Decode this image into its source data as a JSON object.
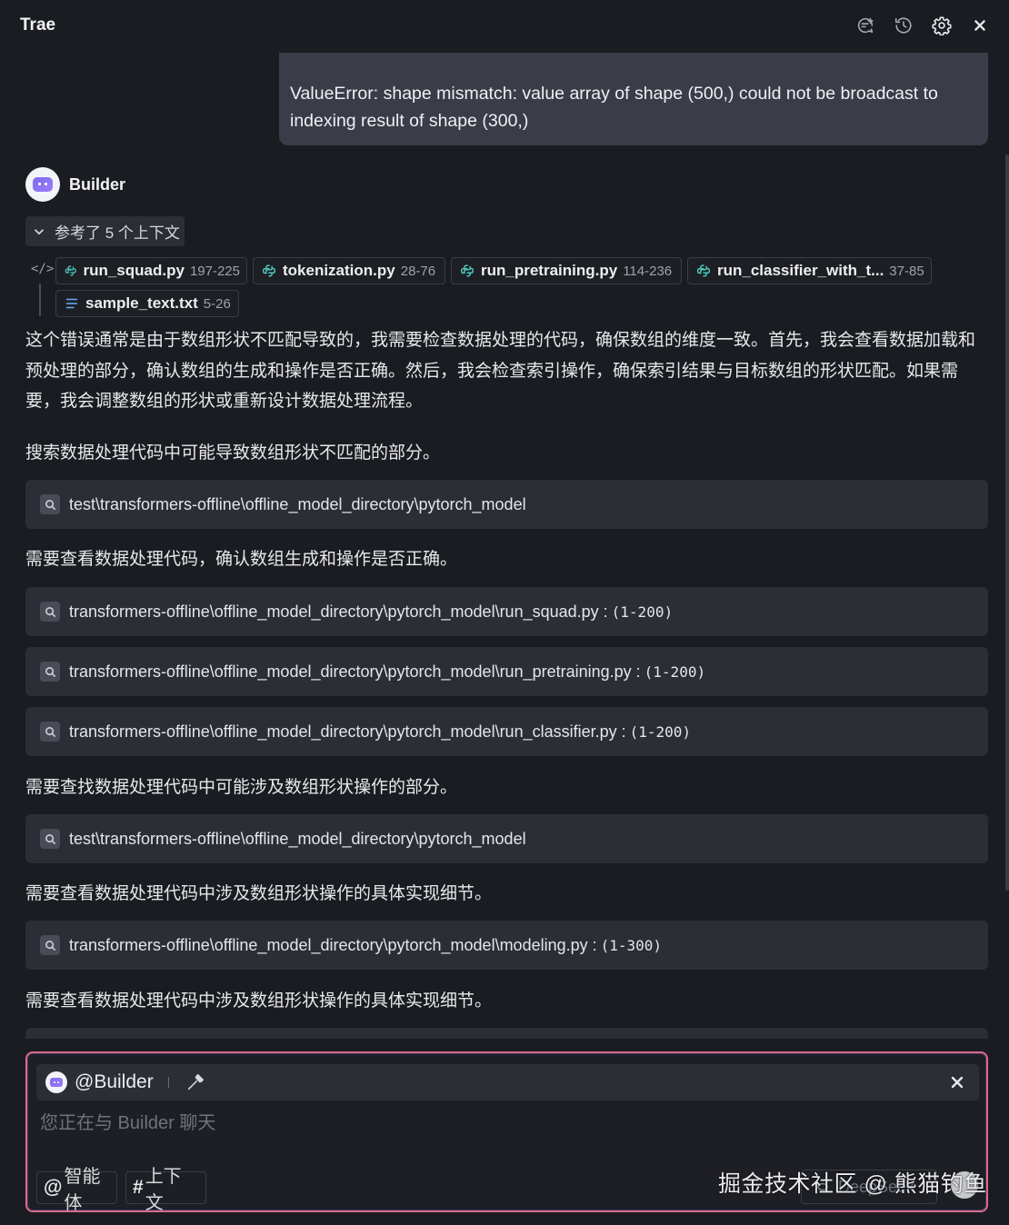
{
  "header": {
    "title": "Trae",
    "icons": [
      "new-chat-icon",
      "history-icon",
      "gear-icon",
      "close-icon"
    ]
  },
  "user_message": {
    "text": "ValueError: shape mismatch: value array of shape (500,) could not be broadcast to indexing result of shape (300,)"
  },
  "assistant": {
    "name": "Builder",
    "context_toggle": "参考了 5 个上下文",
    "context_files": [
      {
        "name": "run_squad.py",
        "range": "197-225",
        "icon": "python-icon"
      },
      {
        "name": "tokenization.py",
        "range": "28-76",
        "icon": "python-icon"
      },
      {
        "name": "run_pretraining.py",
        "range": "114-236",
        "icon": "python-icon"
      },
      {
        "name": "run_classifier_with_t...",
        "range": "37-85",
        "icon": "python-icon"
      },
      {
        "name": "sample_text.txt",
        "range": "5-26",
        "icon": "text-file-icon"
      }
    ]
  },
  "messages": {
    "intro": "这个错误通常是由于数组形状不匹配导致的，我需要检查数据处理的代码，确保数组的维度一致。首先，我会查看数据加载和预处理的部分，确认数组的生成和操作是否正确。然后，我会检查索引操作，确保索引结果与目标数组的形状匹配。如果需要，我会调整数组的形状或重新设计数据处理流程。",
    "step1": "搜索数据处理代码中可能导致数组形状不匹配的部分。",
    "step2": "需要查看数据处理代码，确认数组生成和操作是否正确。",
    "step3": "需要查找数据处理代码中可能涉及数组形状操作的部分。",
    "step4": "需要查看数据处理代码中涉及数组形状操作的具体实现细节。",
    "step5": "需要查看数据处理代码中涉及数组形状操作的具体实现细节。"
  },
  "tool_calls": [
    {
      "path": "test\\transformers-offline\\offline_model_directory\\pytorch_model",
      "range": ""
    },
    {
      "path": "transformers-offline\\offline_model_directory\\pytorch_model\\run_squad.py :",
      "range": "(1-200)"
    },
    {
      "path": "transformers-offline\\offline_model_directory\\pytorch_model\\run_pretraining.py :",
      "range": "(1-200)"
    },
    {
      "path": "transformers-offline\\offline_model_directory\\pytorch_model\\run_classifier.py :",
      "range": "(1-200)"
    },
    {
      "path": "test\\transformers-offline\\offline_model_directory\\pytorch_model",
      "range": ""
    },
    {
      "path": "transformers-offline\\offline_model_directory\\pytorch_model\\modeling.py :",
      "range": "(1-300)"
    }
  ],
  "input": {
    "mention": "@Builder",
    "placeholder": "您正在与 Builder 聊天",
    "value": "",
    "agent_pill_symbol": "@",
    "agent_pill_label": "智能体",
    "context_pill_symbol": "#",
    "context_pill_label": "上下文",
    "model_partial": "DeepSeek"
  },
  "watermark": "掘金技术社区 @ 熊猫钓鱼",
  "colors": {
    "background": "#1b1c21",
    "panel": "#2c2e35",
    "bubble": "#3a3d47",
    "python_icon": "#4cc8c0",
    "input_border": "#d96b86"
  }
}
